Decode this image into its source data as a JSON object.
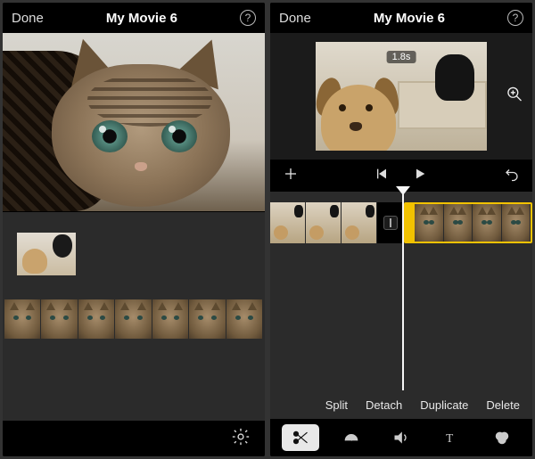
{
  "left": {
    "header": {
      "done": "Done",
      "title": "My Movie 6",
      "help": "?"
    },
    "timeline_clip_frame_count": 7,
    "icons": {
      "gear": "gear-icon"
    }
  },
  "right": {
    "header": {
      "done": "Done",
      "title": "My Movie 6",
      "help": "?"
    },
    "preview": {
      "time_badge": "1.8s",
      "magnify_icon": "magnify-icon"
    },
    "transport": {
      "add_icon": "plus-icon",
      "prev_icon": "skip-back-icon",
      "play_icon": "play-icon",
      "undo_icon": "undo-icon"
    },
    "timeline": {
      "clip_a_frames": 3,
      "transition_icon": "transition-icon",
      "clip_b_frames": 4
    },
    "actions": {
      "split": "Split",
      "detach": "Detach",
      "duplicate": "Duplicate",
      "delete": "Delete"
    },
    "tabs": {
      "scissors": "scissors-icon",
      "speed": "speed-icon",
      "volume": "volume-icon",
      "text": "text-icon",
      "filters": "filters-icon",
      "selected": "scissors"
    }
  }
}
